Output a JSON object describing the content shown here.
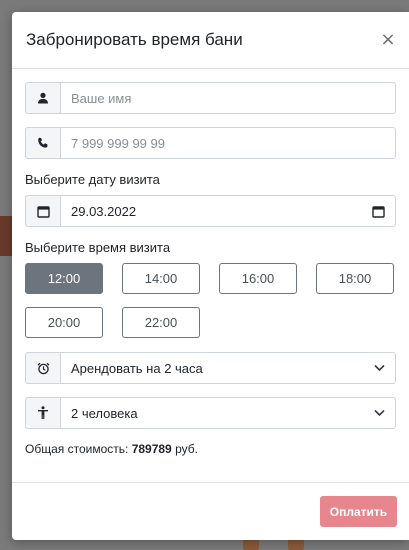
{
  "modal": {
    "title": "Забронировать время бани",
    "close_label": "×"
  },
  "form": {
    "name_placeholder": "Ваше имя",
    "phone_placeholder": "7 999 999 99 99",
    "date_label": "Выберите дату визита",
    "date_value": "29.03.2022",
    "time_label": "Выберите время визита",
    "times": [
      {
        "label": "12:00",
        "selected": true
      },
      {
        "label": "14:00",
        "selected": false
      },
      {
        "label": "16:00",
        "selected": false
      },
      {
        "label": "18:00",
        "selected": false
      },
      {
        "label": "20:00",
        "selected": false
      },
      {
        "label": "22:00",
        "selected": false
      }
    ],
    "duration_value": "Арендовать на 2 часа",
    "guests_value": "2 человека"
  },
  "total": {
    "label": "Общая стоимость:",
    "amount": "789789",
    "currency": "руб."
  },
  "footer": {
    "pay_label": "Оплатить"
  },
  "colors": {
    "accent_selected": "#6c757d",
    "pay_button": "#e8868d",
    "backdrop": "#6b6b6b"
  },
  "icons": {
    "name": "user-icon",
    "phone": "phone-icon",
    "date": "calendar-icon",
    "duration": "alarm-clock-icon",
    "guests": "person-icon"
  }
}
